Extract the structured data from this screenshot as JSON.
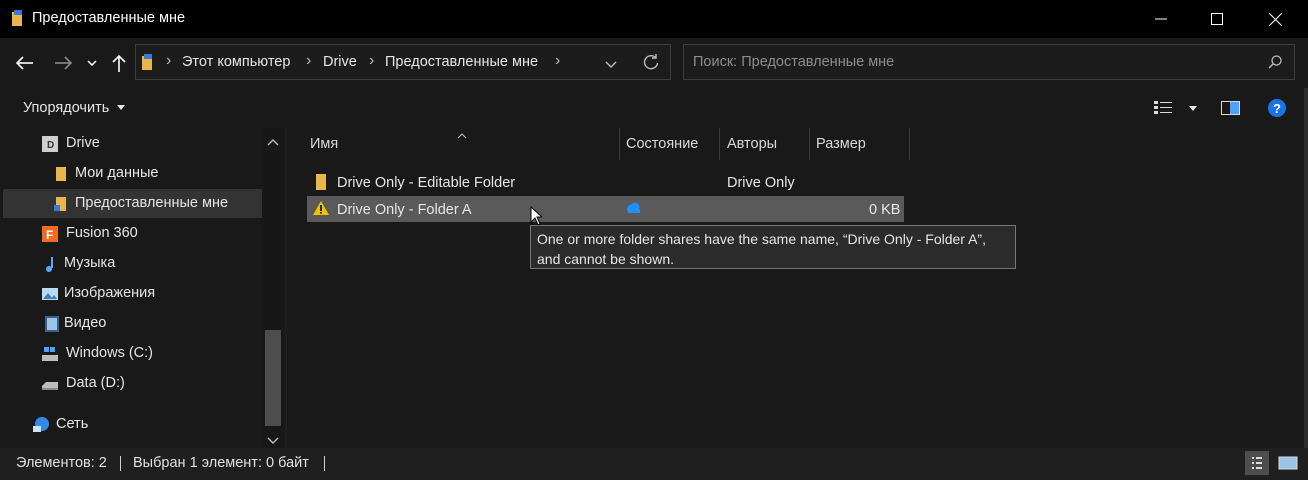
{
  "window": {
    "title": "Предоставленные мне",
    "minimize_icon": "minimize-icon",
    "maximize_icon": "maximize-icon",
    "close_icon": "close-icon"
  },
  "address": {
    "crumbs": [
      "Этот компьютер",
      "Drive",
      "Предоставленные мне"
    ],
    "search_placeholder": "Поиск: Предоставленные мне"
  },
  "toolbar": {
    "organize_label": "Упорядочить"
  },
  "nav": {
    "items": [
      {
        "label": "Drive",
        "icon": "drive-icon"
      },
      {
        "label": "Мои данные",
        "icon": "folder-icon"
      },
      {
        "label": "Предоставленные мне",
        "icon": "shared-folder-icon",
        "selected": true
      },
      {
        "label": "Fusion 360",
        "icon": "fusion-360-icon"
      },
      {
        "label": "Музыка",
        "icon": "music-icon"
      },
      {
        "label": "Изображения",
        "icon": "pictures-icon"
      },
      {
        "label": "Видео",
        "icon": "video-icon"
      },
      {
        "label": "Windows (C:)",
        "icon": "windows-drive-icon"
      },
      {
        "label": "Data (D:)",
        "icon": "disk-drive-icon"
      },
      {
        "label": "Сеть",
        "icon": "network-icon"
      }
    ]
  },
  "columns": [
    "Имя",
    "Состояние",
    "Авторы",
    "Размер"
  ],
  "rows": [
    {
      "name": "Drive Only - Editable Folder",
      "status": "",
      "authors": "Drive Only",
      "size": "",
      "icon": "folder-icon"
    },
    {
      "name": "Drive Only - Folder A",
      "status": "cloud",
      "authors": "",
      "size": "0 KB",
      "icon": "warning-icon",
      "selected": true
    }
  ],
  "tooltip": {
    "line1": "One or more folder shares have the same name, “Drive Only - Folder A”,",
    "line2": "and cannot be shown."
  },
  "status": {
    "items_count": "Элементов: 2",
    "selected": "Выбран 1 элемент: 0 байт"
  },
  "colors": {
    "background": "#191919",
    "titlebar": "#000000",
    "selected_row": "#5a5a5a",
    "cloud": "#1e90ff",
    "help": "#1a73e8",
    "warning": "#f2c200"
  }
}
